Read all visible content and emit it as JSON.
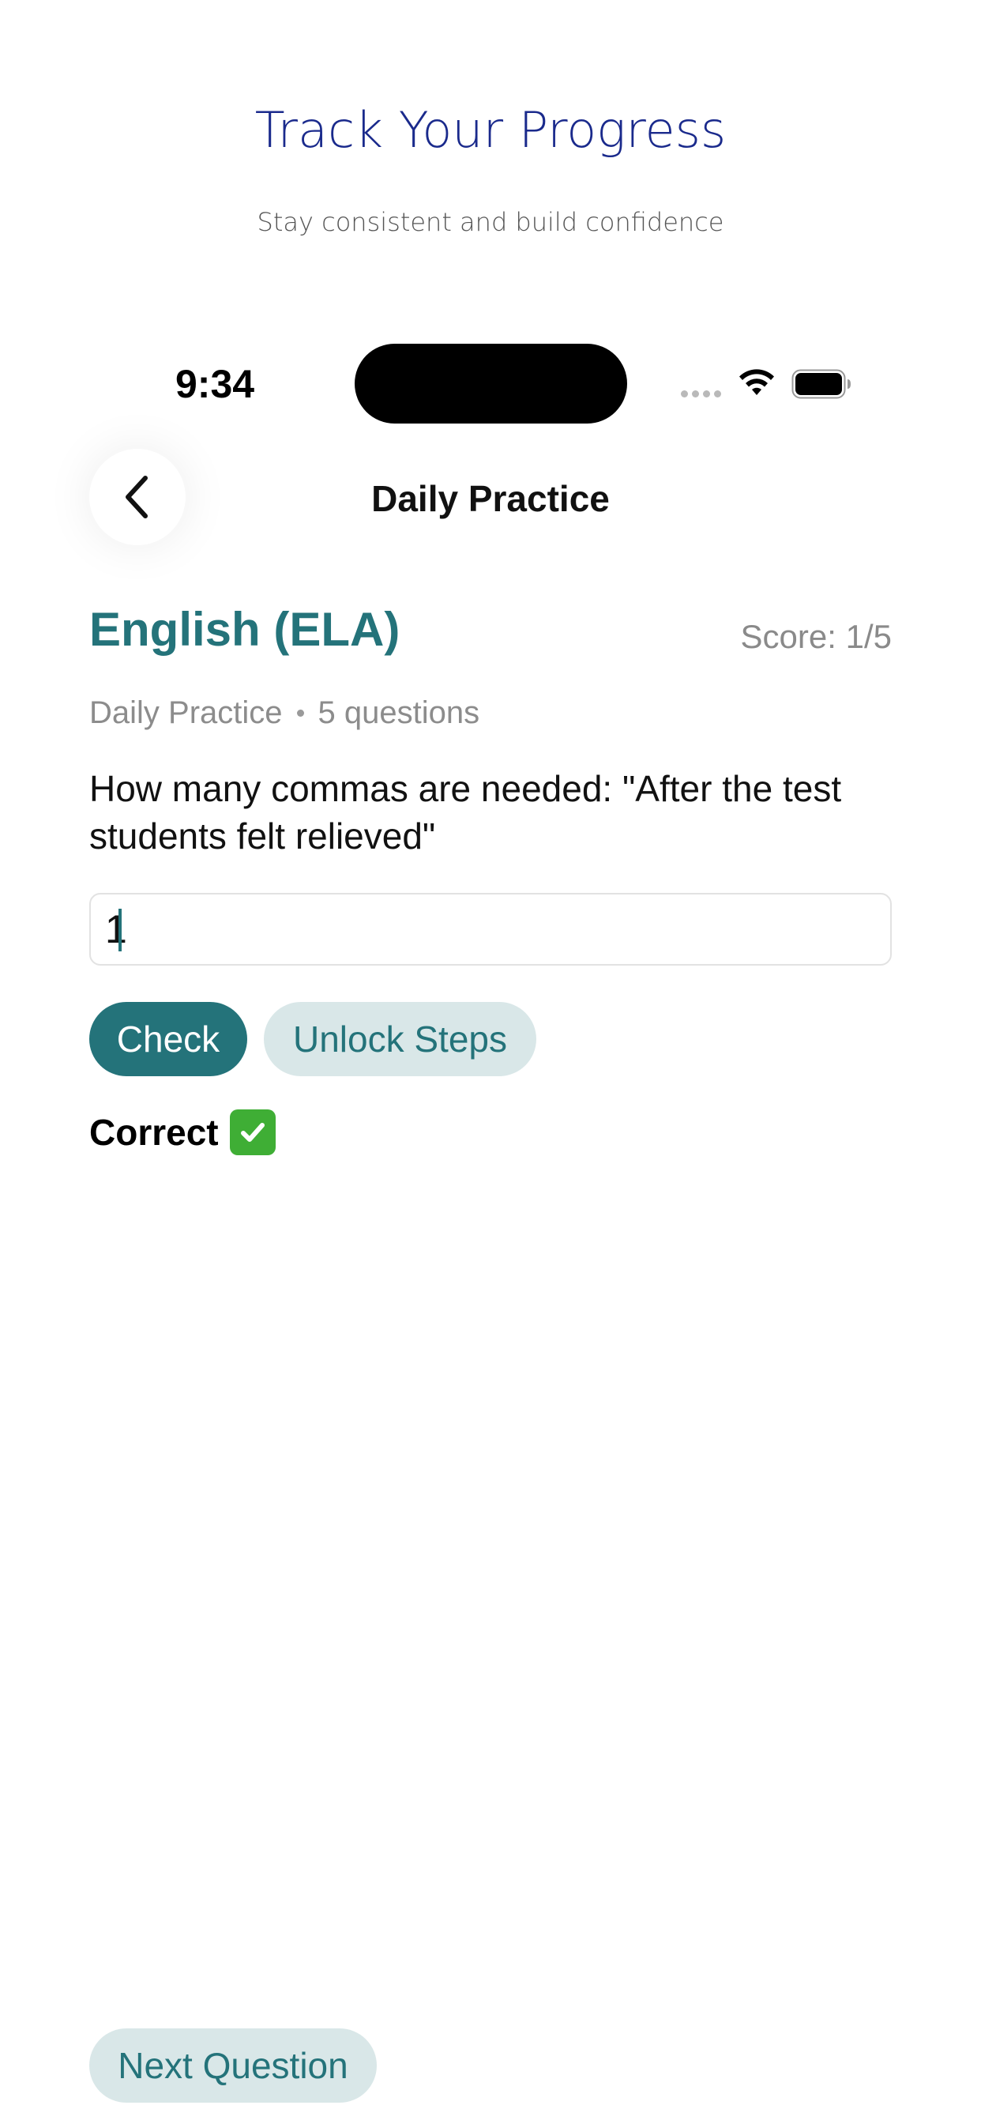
{
  "marketing": {
    "title": "Track Your Progress",
    "subtitle": "Stay consistent and build confidence"
  },
  "status_bar": {
    "time": "9:34",
    "icons": [
      "signal-dots-icon",
      "wifi-icon",
      "battery-icon"
    ]
  },
  "nav": {
    "back_icon": "chevron-left-icon",
    "title": "Daily Practice"
  },
  "practice": {
    "subject": "English (ELA)",
    "score": "Score: 1/5",
    "mode": "Daily Practice",
    "question_count": "5 questions",
    "question": "How many commas are needed: \"After the test students felt relieved\"",
    "answer_value": "1",
    "check_label": "Check",
    "unlock_label": "Unlock Steps",
    "feedback": "Correct",
    "feedback_icon": "check-mark-button-icon",
    "next_label": "Next Question"
  },
  "colors": {
    "accent": "#24737a",
    "accent_light": "#d9e7e8",
    "marketing_title": "#1a2a8c",
    "success": "#3fae35"
  }
}
